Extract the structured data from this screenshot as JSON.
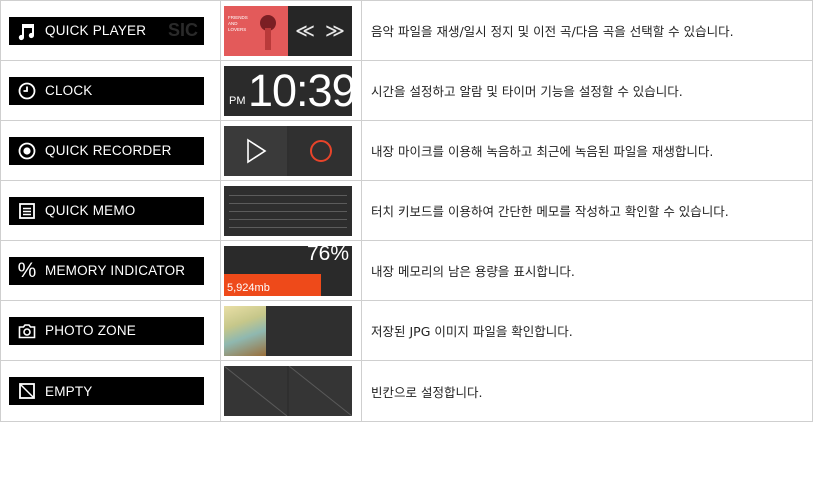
{
  "rows": [
    {
      "label": "QUICK PLAYER",
      "icon": "music-note-icon",
      "ghost": "SIC",
      "description": "음악 파일을 재생/일시 정지 및 이전 곡/다음 곡을 선택할 수 있습니다.",
      "widget": {
        "album_text": "FRIENDS\nAND\nLOVERS",
        "prev_symbol": "≪",
        "next_symbol": "≫",
        "album_color": "#e35a5a"
      }
    },
    {
      "label": "CLOCK",
      "icon": "clock-icon",
      "description": "시간을 설정하고 알람 및 타이머 기능을 설정할 수 있습니다.",
      "widget": {
        "ampm": "PM",
        "time": "10:39"
      }
    },
    {
      "label": "QUICK RECORDER",
      "icon": "record-icon",
      "description": "내장 마이크를 이용해 녹음하고 최근에 녹음된 파일을 재생합니다.",
      "widget": {
        "play_icon": "play-icon",
        "record_icon": "record-circle-icon",
        "record_color": "#e8442a"
      }
    },
    {
      "label": "QUICK MEMO",
      "icon": "memo-icon",
      "description": "터치 키보드를 이용하여 간단한 메모를 작성하고 확인할 수 있습니다."
    },
    {
      "label": "MEMORY INDICATOR",
      "icon": "percent-icon",
      "description": "내장 메모리의 남은 용량을 표시합니다.",
      "widget": {
        "percent": "76%",
        "used_fraction": 0.76,
        "free": "5,924mb",
        "bar_color": "#ee4a1a"
      }
    },
    {
      "label": "PHOTO ZONE",
      "icon": "camera-icon",
      "description": "저장된 JPG 이미지 파일을 확인합니다."
    },
    {
      "label": "EMPTY",
      "icon": "empty-slot-icon",
      "description": "빈칸으로 설정합니다."
    }
  ]
}
